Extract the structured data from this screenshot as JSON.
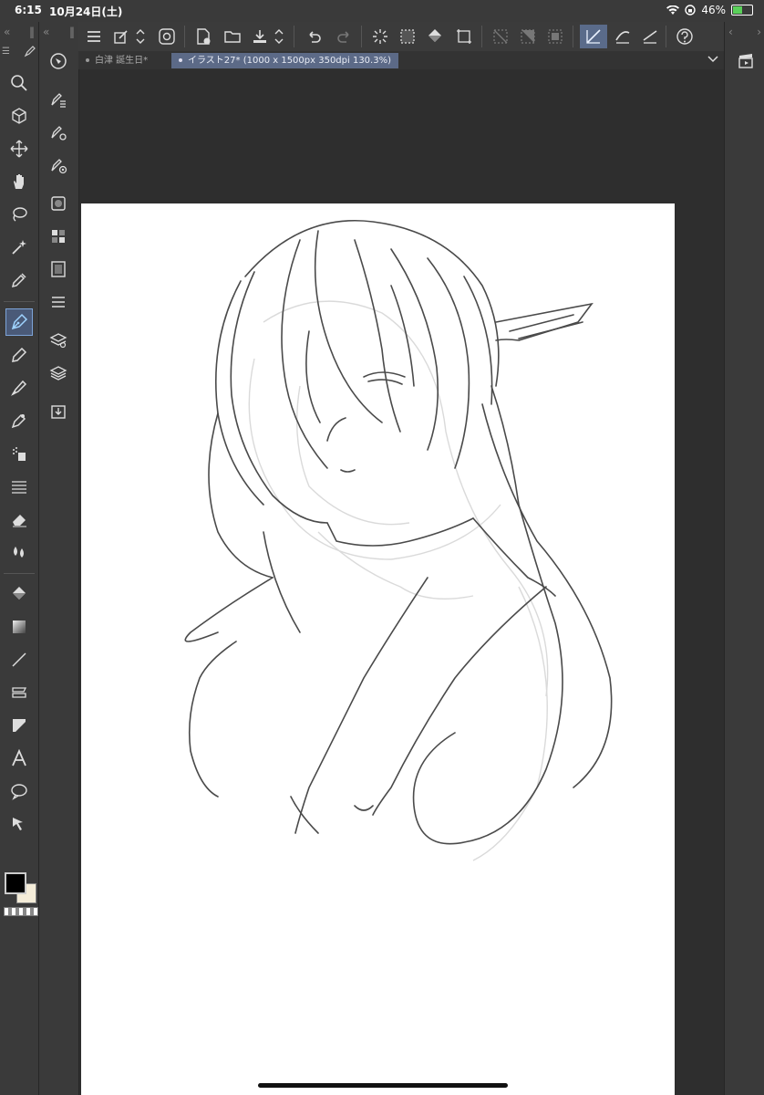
{
  "status": {
    "time": "6:15",
    "date": "10月24日(土)",
    "battery": "46%",
    "battery_level": 0.46
  },
  "tabs": [
    {
      "label": "白津 誕生日*"
    },
    {
      "label": "イラスト27* (1000 x 1500px 350dpi 130.3%)"
    }
  ],
  "icons": {
    "menu": "menu-icon",
    "chevron": "chevron-down-icon"
  },
  "colors": {
    "ui_bg": "#3a3a3a",
    "canvas_bg": "#2e2e2e",
    "active": "#5c6a87",
    "fg_color": "#000000",
    "bg_color": "#f4ecd8"
  }
}
